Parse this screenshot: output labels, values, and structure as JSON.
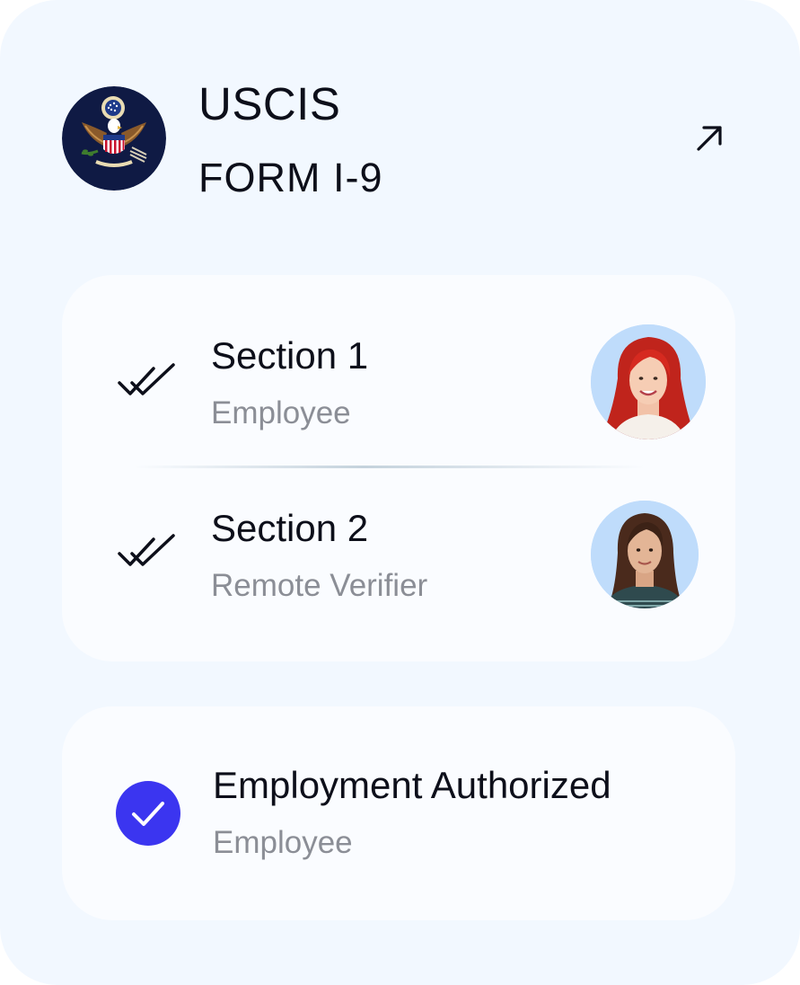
{
  "header": {
    "seal_icon": "uscis-seal-icon",
    "agency": "USCIS",
    "form_name": "FORM I-9",
    "open_icon": "arrow-up-right-icon"
  },
  "sections": [
    {
      "title": "Section 1",
      "subtitle": "Employee",
      "status_icon": "double-check-icon",
      "avatar": "avatar-employee"
    },
    {
      "title": "Section 2",
      "subtitle": "Remote Verifier",
      "status_icon": "double-check-icon",
      "avatar": "avatar-verifier"
    }
  ],
  "authorization": {
    "title": "Employment Authorized",
    "subtitle": "Employee",
    "status_icon": "check-circle-icon",
    "accent_color": "#3b35f0"
  },
  "colors": {
    "background": "#f2f8ff",
    "panel": "#fafcff",
    "text_primary": "#0d0f1a",
    "text_secondary": "#8b8e96",
    "avatar_bg": "#bfdcfb"
  }
}
